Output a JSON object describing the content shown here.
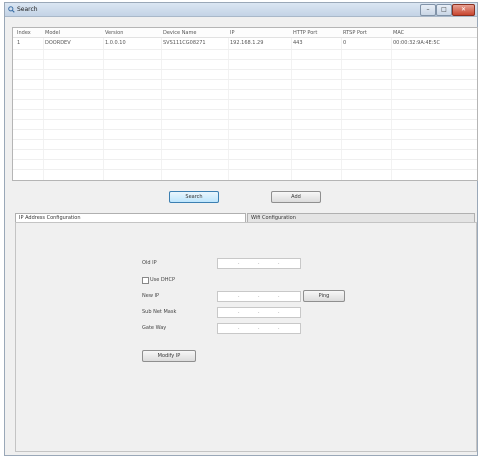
{
  "window": {
    "title": "Search",
    "minimize": "–",
    "maximize": "□",
    "close": "✕"
  },
  "device_list": {
    "columns": [
      "Index",
      "Model",
      "Version",
      "Device Name",
      "IP",
      "HTTP Port",
      "RTSP Port",
      "MAC"
    ],
    "rows": [
      [
        "1",
        "DOORDEV",
        "1.0.0.10",
        "SVS111CG08271",
        "192.168.1.29",
        "443",
        "0",
        "00:00:32:9A:4E:5C"
      ]
    ]
  },
  "actions": {
    "search": "Search",
    "add": "Add"
  },
  "tabs": {
    "ip_config": "IP Address Configuration",
    "wifi_config": "Wifi Configuration"
  },
  "form": {
    "old_ip_label": "Old IP",
    "dhcp_label": "Use DHCP",
    "new_ip_label": "New IP",
    "ping_button": "Ping",
    "subnet_label": "Sub Net Mask",
    "gateway_label": "Gate Way",
    "modify_button": "Modify IP",
    "ip_separator": "."
  }
}
